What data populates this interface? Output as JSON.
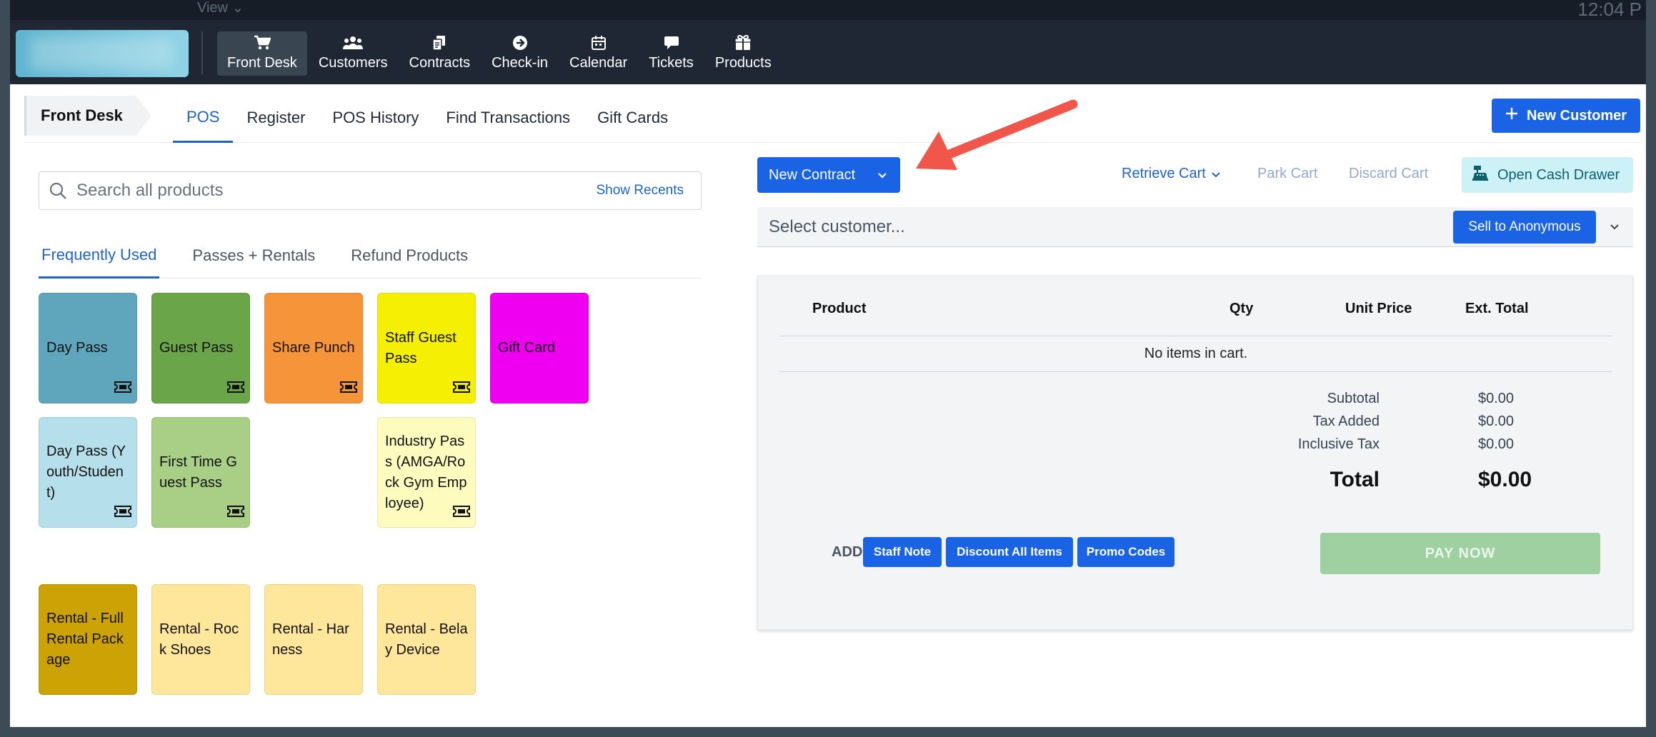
{
  "topbar": {
    "view_menu": "View ⌄",
    "clock": "12:04 P",
    "nav": [
      {
        "label": "Front Desk",
        "icon": "cart-icon",
        "active": true
      },
      {
        "label": "Customers",
        "icon": "users-icon"
      },
      {
        "label": "Contracts",
        "icon": "contracts-icon"
      },
      {
        "label": "Check-in",
        "icon": "check-in-icon"
      },
      {
        "label": "Calendar",
        "icon": "calendar-icon"
      },
      {
        "label": "Tickets",
        "icon": "comment-icon"
      },
      {
        "label": "Products",
        "icon": "products-icon"
      }
    ]
  },
  "subnav": {
    "section": "Front Desk",
    "tabs": [
      {
        "label": "POS",
        "active": true
      },
      {
        "label": "Register"
      },
      {
        "label": "POS History"
      },
      {
        "label": "Find Transactions"
      },
      {
        "label": "Gift Cards"
      }
    ],
    "new_customer_label": "New Customer"
  },
  "products": {
    "search_placeholder": "Search all products",
    "show_recents_label": "Show Recents",
    "tabs": [
      {
        "label": "Frequently Used",
        "active": true
      },
      {
        "label": "Passes + Rentals"
      },
      {
        "label": "Refund Products"
      }
    ],
    "tiles": [
      {
        "label": "Day Pass",
        "color": "#5fa5bb",
        "ticket": true
      },
      {
        "label": "Guest Pass",
        "color": "#6aa54a",
        "ticket": true
      },
      {
        "label": "Share Punch",
        "color": "#f59439",
        "ticket": true
      },
      {
        "label": "Staff Guest Pass",
        "color": "#f5f003",
        "ticket": true
      },
      {
        "label": "Gift Card",
        "color": "#f000f0",
        "ticket": false
      },
      {
        "label": "Day Pass (Youth/Student)",
        "color": "#b5dfea",
        "ticket": true
      },
      {
        "label": "First Time Guest Pass",
        "color": "#a8cf85",
        "ticket": true
      },
      {
        "label": "Industry Pass (AMGA/Rock Gym Employee)",
        "color": "#fdfbbd",
        "ticket": true
      },
      {
        "label": "Rental - Full Rental Package",
        "color": "#cca204",
        "ticket": false
      },
      {
        "label": "Rental - Rock Shoes",
        "color": "#fee69b",
        "ticket": false
      },
      {
        "label": "Rental - Harness",
        "color": "#fee69b",
        "ticket": false
      },
      {
        "label": "Rental - Belay Device",
        "color": "#fee69b",
        "ticket": false
      }
    ]
  },
  "cart_toolbar": {
    "new_contract_label": "New Contract",
    "retrieve_cart_label": "Retrieve Cart",
    "park_cart_label": "Park Cart",
    "discard_cart_label": "Discard Cart",
    "open_cash_drawer_label": "Open Cash Drawer"
  },
  "customer": {
    "placeholder": "Select customer...",
    "sell_anonymous_label": "Sell to Anonymous"
  },
  "cart": {
    "columns": {
      "product": "Product",
      "qty": "Qty",
      "unit_price": "Unit Price",
      "ext_total": "Ext. Total"
    },
    "empty_message": "No items in cart.",
    "subtotal_label": "Subtotal",
    "subtotal": "$0.00",
    "tax_added_label": "Tax Added",
    "tax_added": "$0.00",
    "inclusive_tax_label": "Inclusive Tax",
    "inclusive_tax": "$0.00",
    "total_label": "Total",
    "total": "$0.00",
    "add_label": "ADD",
    "staff_note_label": "Staff Note",
    "discount_all_label": "Discount All Items",
    "promo_codes_label": "Promo Codes",
    "pay_now_label": "PAY NOW"
  }
}
